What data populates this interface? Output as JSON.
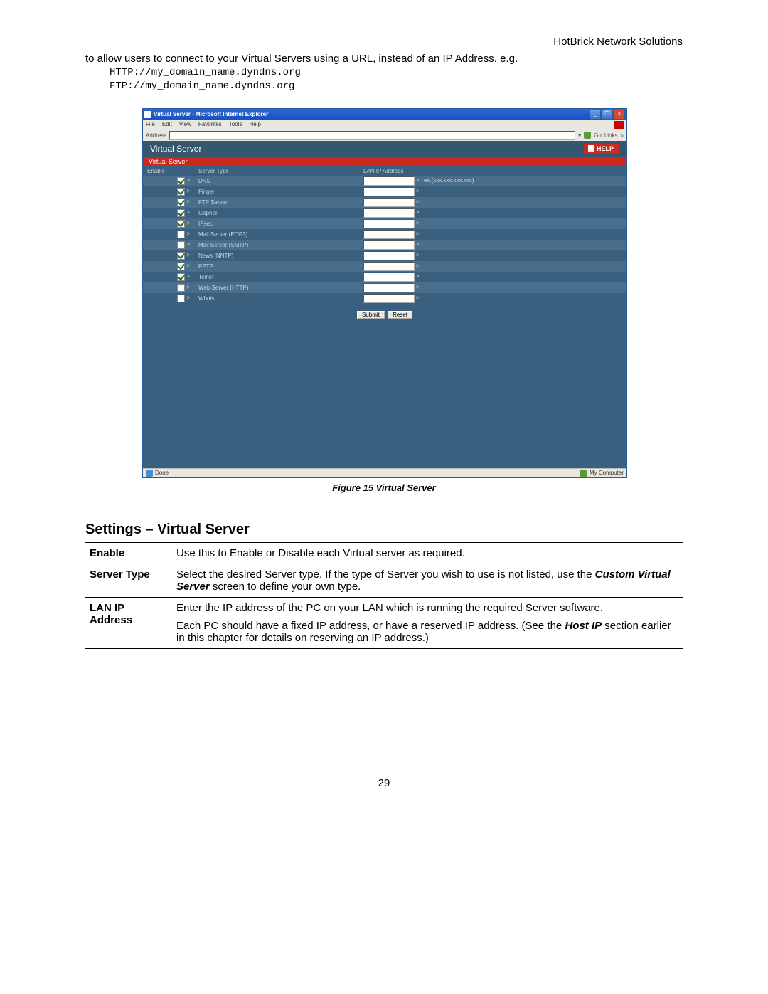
{
  "header": {
    "brand": "HotBrick Network Solutions"
  },
  "intro": {
    "text": "to allow users to connect to your Virtual Servers using a URL, instead of an IP Address. e.g.",
    "url1": "HTTP://my_domain_name.dyndns.org",
    "url2": "FTP://my_domain_name.dyndns.org"
  },
  "screenshot": {
    "window_title": "Virtual Server - Microsoft Internet Explorer",
    "menu": [
      "File",
      "Edit",
      "View",
      "Favorites",
      "Tools",
      "Help"
    ],
    "address_label": "Address",
    "go_label": "Go",
    "links_label": "Links",
    "page_heading": "Virtual Server",
    "help_label": "HELP",
    "section_label": "Virtual Server",
    "col_enable": "Enable",
    "col_type": "Server Type",
    "col_ip": "LAN IP Address",
    "rows": [
      {
        "enabled": true,
        "type": "DNS",
        "hint": "ex.(xxx.xxx.xxx.xxx)"
      },
      {
        "enabled": true,
        "type": "Finger",
        "hint": ""
      },
      {
        "enabled": true,
        "type": "FTP Server",
        "hint": ""
      },
      {
        "enabled": true,
        "type": "Gopher",
        "hint": ""
      },
      {
        "enabled": true,
        "type": "IPsec",
        "hint": ""
      },
      {
        "enabled": false,
        "type": "Mail Server (POP3)",
        "hint": ""
      },
      {
        "enabled": false,
        "type": "Mail Server (SMTP)",
        "hint": ""
      },
      {
        "enabled": true,
        "type": "News (NNTP)",
        "hint": ""
      },
      {
        "enabled": true,
        "type": "PPTP",
        "hint": ""
      },
      {
        "enabled": true,
        "type": "Telnet",
        "hint": ""
      },
      {
        "enabled": false,
        "type": "Web Server (HTTP)",
        "hint": ""
      },
      {
        "enabled": false,
        "type": "Whois",
        "hint": ""
      }
    ],
    "submit_label": "Submit",
    "reset_label": "Reset",
    "status_done": "Done",
    "status_zone": "My Computer"
  },
  "figure_caption": "Figure 15 Virtual Server",
  "settings": {
    "heading": "Settings – Virtual Server",
    "rows": [
      {
        "label": "Enable",
        "body": "Use this to Enable or Disable each Virtual server as required."
      },
      {
        "label": "Server Type",
        "body": "Select the desired Server type. If the type of Server you wish to use is not listed, use the ",
        "bold_italic": "Custom Virtual Server",
        "body2": " screen to define your own type."
      },
      {
        "label": "LAN IP Address",
        "body": "Enter the IP address of the PC on your LAN which is running the required Server software.",
        "body_p2a": "Each PC should have a fixed IP address, or have a reserved IP address. (See the ",
        "body_p2_bi": "Host IP",
        "body_p2b": " section earlier in this chapter for details on reserving an IP address.)"
      }
    ]
  },
  "page_number": "29"
}
